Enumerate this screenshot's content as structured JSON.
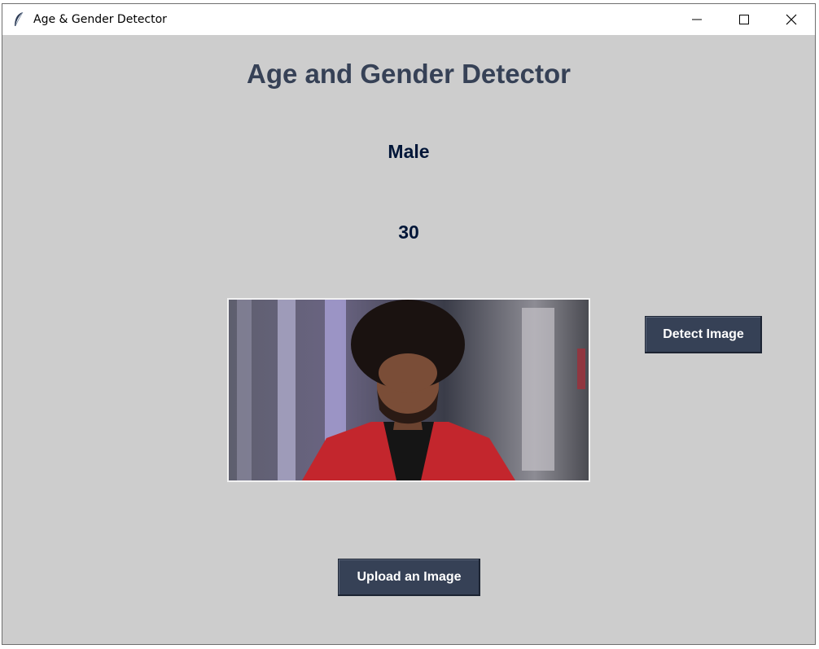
{
  "window": {
    "title": "Age & Gender Detector",
    "controls": [
      "minimize-icon",
      "maximize-icon",
      "close-icon"
    ]
  },
  "main": {
    "heading": "Age and Gender Detector",
    "gender_result": "Male",
    "age_result": "30",
    "photo_icon": "person-photo"
  },
  "buttons": {
    "detect_label": "Detect Image",
    "upload_label": "Upload an Image"
  },
  "colors": {
    "window_bg": "#cdcdcd",
    "heading": "#364156",
    "result_text": "#011638",
    "button_bg": "#364156",
    "button_text": "#ffffff"
  }
}
